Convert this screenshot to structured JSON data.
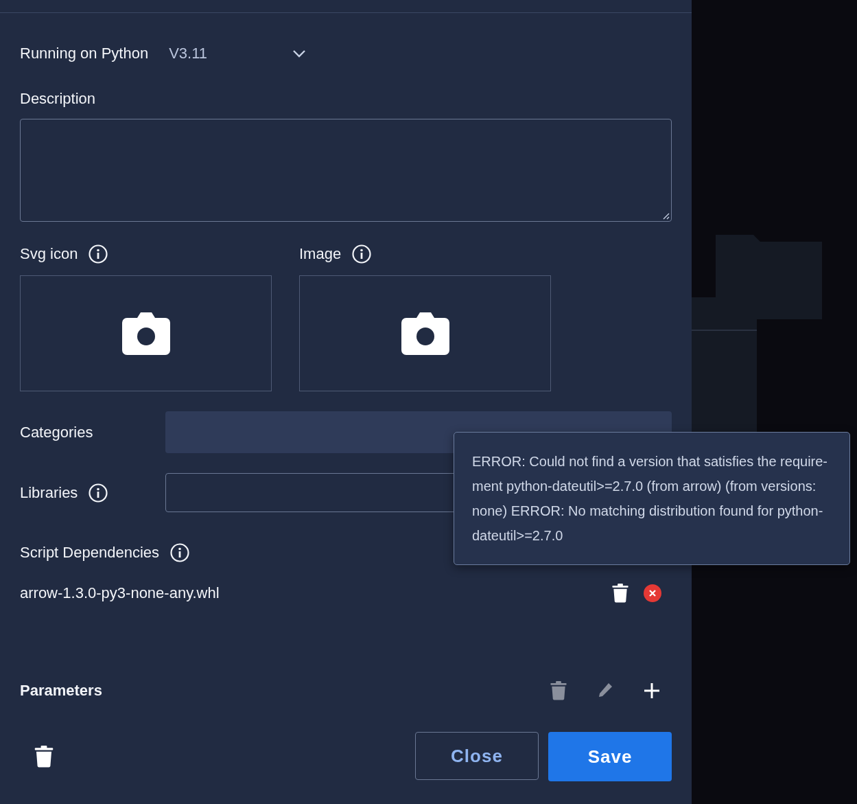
{
  "runtime": {
    "label": "Running on Python",
    "value": "V3.11"
  },
  "description": {
    "label": "Description"
  },
  "uploads": [
    {
      "label": "Svg icon",
      "info": true
    },
    {
      "label": "Image",
      "info": true
    }
  ],
  "categories": {
    "label": "Categories"
  },
  "libraries": {
    "label": "Libraries",
    "info": true
  },
  "script_dependencies": {
    "label": "Script Dependencies",
    "info": true,
    "files": [
      {
        "name": "arrow-1.3.0-py3-none-any.whl",
        "error": true
      }
    ]
  },
  "tooltip": {
    "text": "ERROR: Could not find a version that satisfies the require-ment python-dateutil>=2.7.0 (from arrow) (from versions: none) ERROR: No matching distribution found for python-dateutil>=2.7.0"
  },
  "parameters": {
    "title": "Parameters",
    "actions": [
      {
        "kind": "delete",
        "disabled": true
      },
      {
        "kind": "edit",
        "disabled": true
      },
      {
        "kind": "add",
        "disabled": false
      }
    ]
  },
  "footer": {
    "buttons": [
      {
        "label": "Close",
        "kind": "secondary"
      },
      {
        "label": "Save",
        "kind": "primary"
      }
    ]
  }
}
